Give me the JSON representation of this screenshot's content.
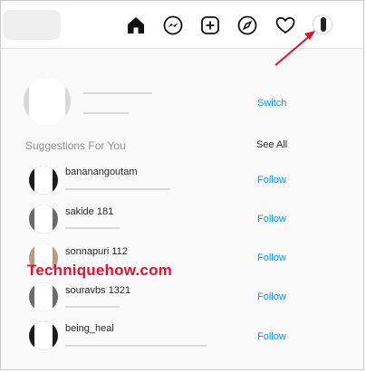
{
  "nav": {
    "icons": [
      "home-icon",
      "messenger-icon",
      "new-post-icon",
      "explore-icon",
      "activity-heart-icon",
      "profile-avatar-icon"
    ]
  },
  "profile": {
    "switch_label": "Switch"
  },
  "suggestions": {
    "heading": "Suggestions For You",
    "see_all_label": "See All",
    "items": [
      {
        "username": "bananangoutam",
        "follow_label": "Follow"
      },
      {
        "username": "sakide 181",
        "follow_label": "Follow"
      },
      {
        "username": "sonnapuri 112",
        "follow_label": "Follow"
      },
      {
        "username": "souravbs 1321",
        "follow_label": "Follow"
      },
      {
        "username": "being_heal",
        "follow_label": "Follow"
      }
    ]
  },
  "watermark": {
    "text": "Techniquehow.com"
  },
  "colors": {
    "link": "#0095f6",
    "watermark": "#e8102b",
    "arrow": "#e8102b"
  }
}
